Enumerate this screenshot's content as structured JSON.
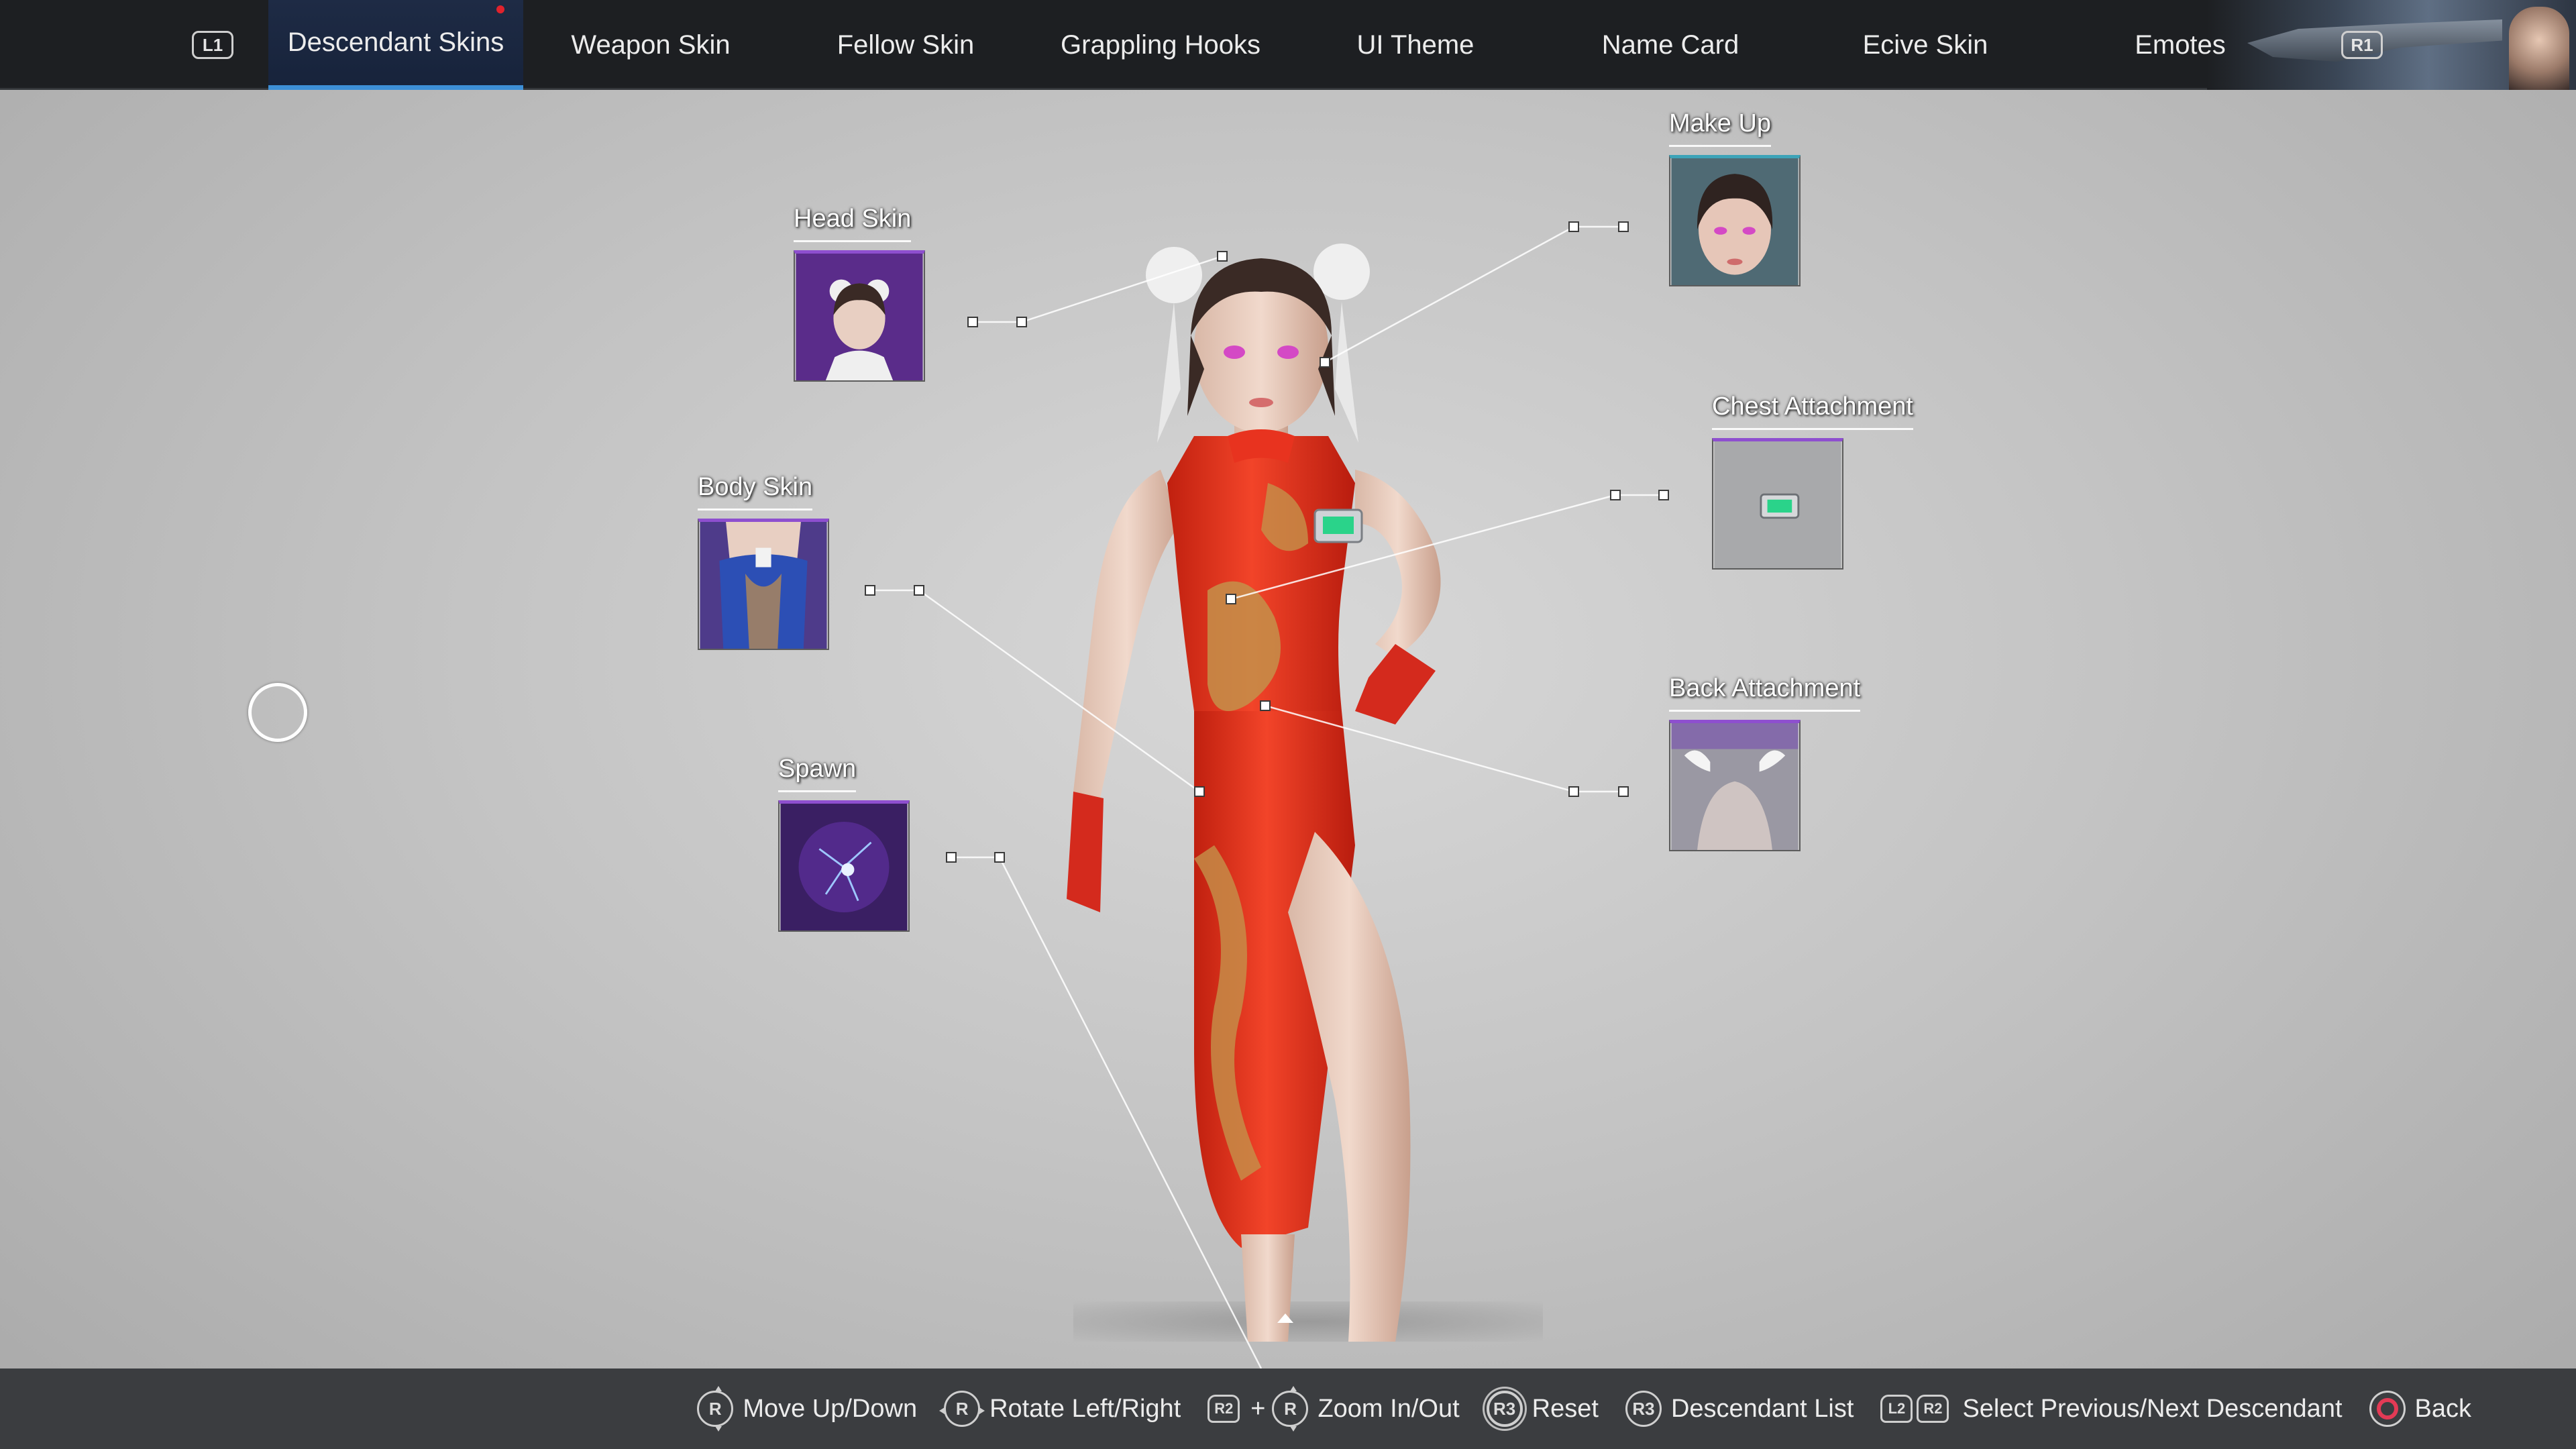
{
  "nav": {
    "prev_button": "L1",
    "next_button": "R1",
    "tabs": [
      {
        "label": "Descendant Skins",
        "active": true,
        "has_notification": true
      },
      {
        "label": "Weapon Skin",
        "active": false
      },
      {
        "label": "Fellow Skin",
        "active": false
      },
      {
        "label": "Grappling Hooks",
        "active": false
      },
      {
        "label": "UI Theme",
        "active": false
      },
      {
        "label": "Name Card",
        "active": false
      },
      {
        "label": "Ecive Skin",
        "active": false
      },
      {
        "label": "Emotes",
        "active": false
      }
    ]
  },
  "slots": {
    "head_skin": "Head Skin",
    "body_skin": "Body Skin",
    "spawn": "Spawn",
    "make_up": "Make Up",
    "chest_attachment": "Chest Attachment",
    "back_attachment": "Back Attachment"
  },
  "footer": {
    "move_button": "R",
    "move": "Move Up/Down",
    "rotate_button": "R",
    "rotate": "Rotate Left/Right",
    "zoom_button_1": "R2",
    "zoom_plus": "+",
    "zoom_button_2": "R",
    "zoom": "Zoom In/Out",
    "reset_button": "R3",
    "reset": "Reset",
    "list_button": "R3",
    "list": "Descendant List",
    "select_button_1": "L2",
    "select_button_2": "R2",
    "select": "Select Previous/Next Descendant",
    "back": "Back"
  },
  "colors": {
    "accent": "#3d8fd6",
    "dress": "#e8331f",
    "rare_frame": "#8e4fcf",
    "back_button": "#e33a55"
  }
}
